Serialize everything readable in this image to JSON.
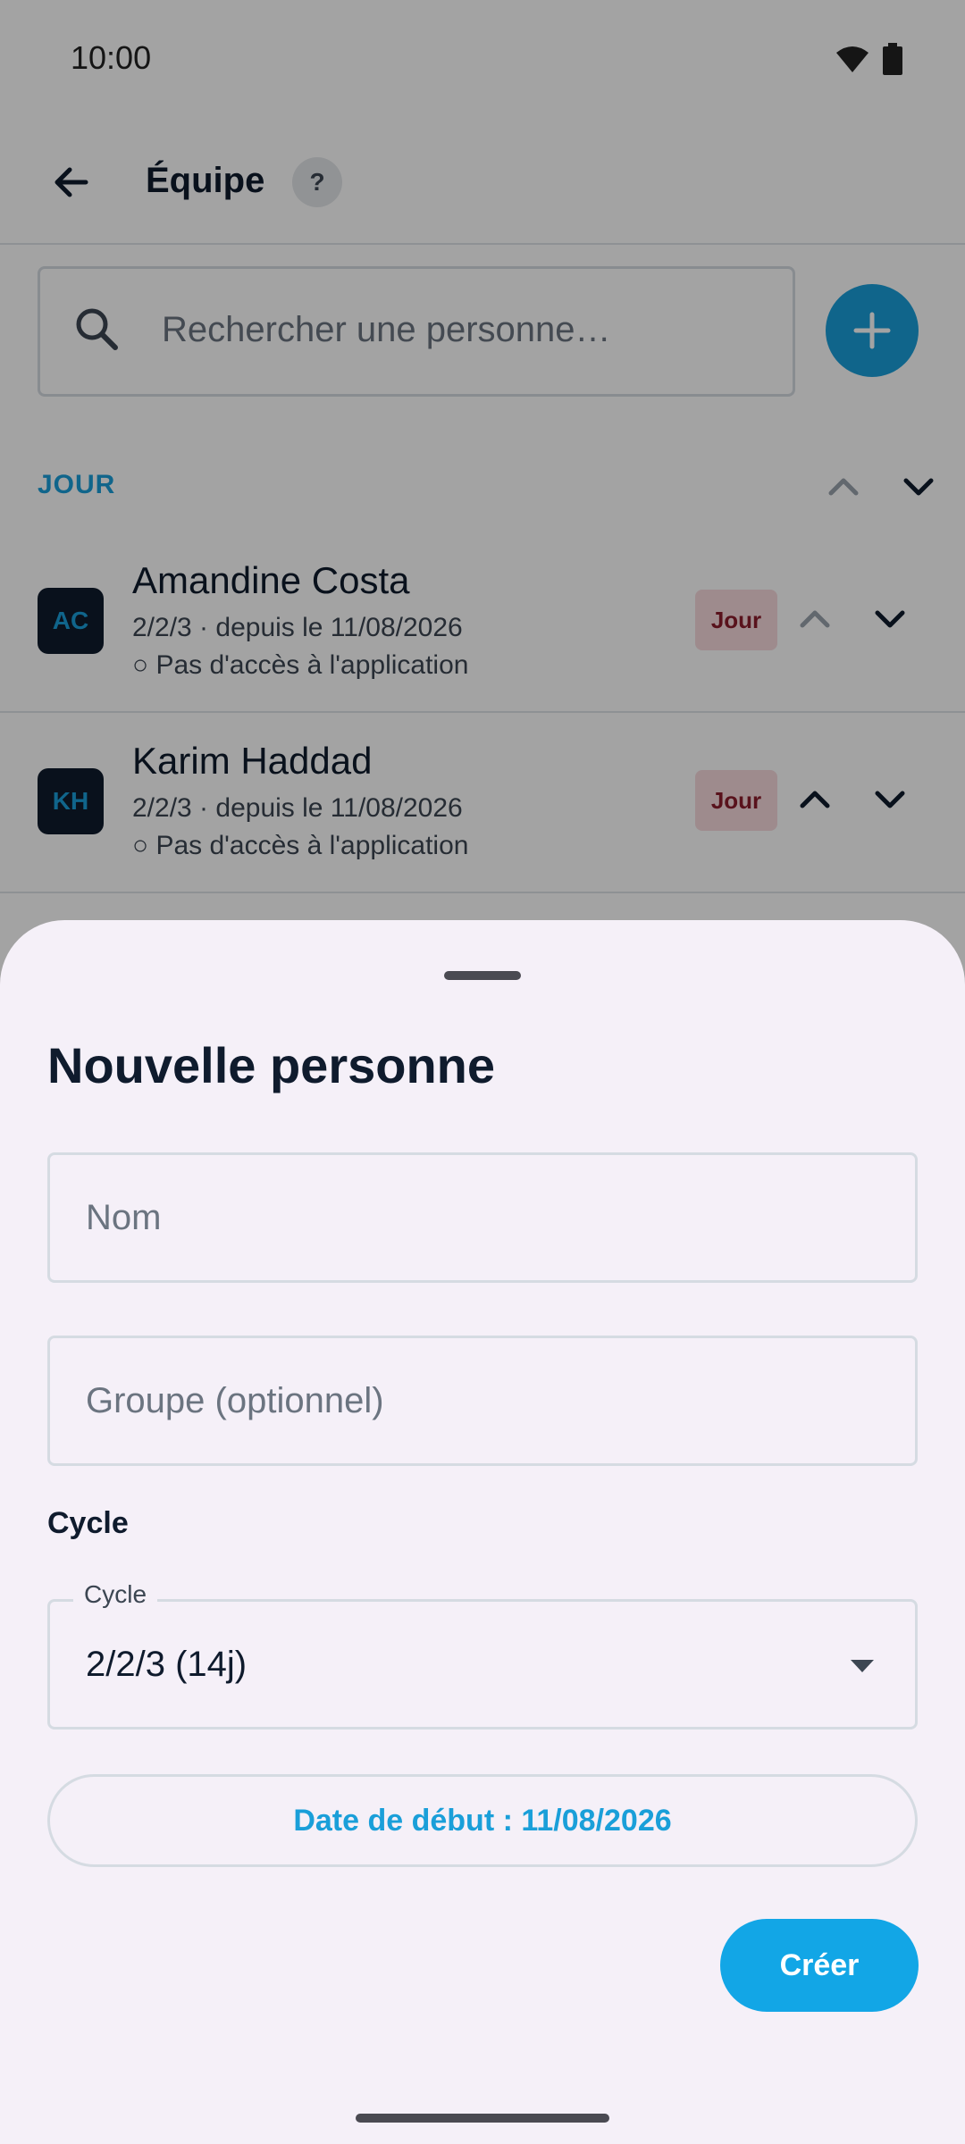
{
  "status": {
    "time": "10:00"
  },
  "header": {
    "title": "Équipe",
    "help": "?"
  },
  "search": {
    "placeholder": "Rechercher une personne…"
  },
  "section": {
    "label": "JOUR"
  },
  "people": [
    {
      "initials": "AC",
      "name": "Amandine Costa",
      "line1": "2/2/3 · depuis le 11/08/2026",
      "line2": "○ Pas d'accès à l'application",
      "badge": "Jour"
    },
    {
      "initials": "KH",
      "name": "Karim Haddad",
      "line1": "2/2/3 · depuis le 11/08/2026",
      "line2": "○ Pas d'accès à l'application",
      "badge": "Jour"
    }
  ],
  "sheet": {
    "title": "Nouvelle personne",
    "name_placeholder": "Nom",
    "group_placeholder": "Groupe (optionnel)",
    "cycle_section_label": "Cycle",
    "cycle_legend": "Cycle",
    "cycle_value": "2/2/3 (14j)",
    "start_date_label": "Date de début : 11/08/2026",
    "create_label": "Créer"
  },
  "colors": {
    "accent": "#1a9fd9",
    "badge_bg": "#f7d9dd",
    "badge_text": "#8b1d2c",
    "sheet_bg": "#f5f0f8"
  }
}
